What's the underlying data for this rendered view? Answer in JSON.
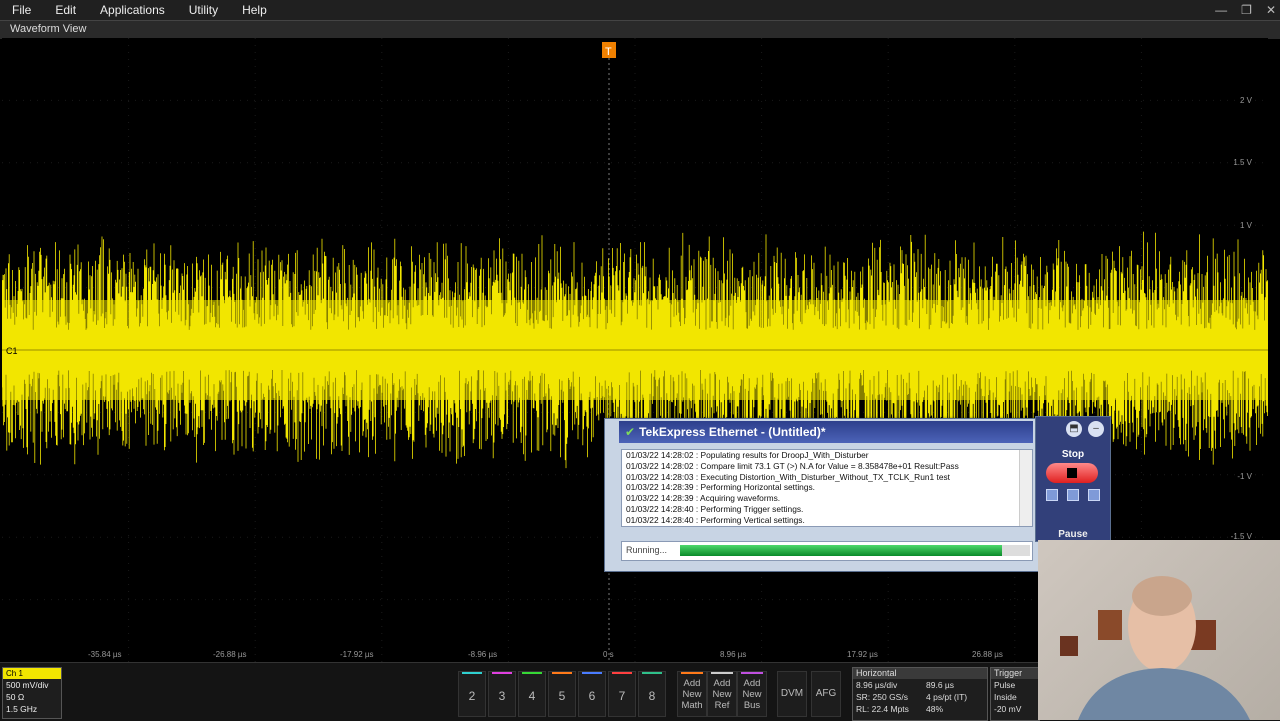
{
  "menu": {
    "items": [
      "File",
      "Edit",
      "Applications",
      "Utility",
      "Help"
    ]
  },
  "window_buttons": {
    "minimize": "—",
    "restore": "❐",
    "close": "✕"
  },
  "waveform_view": {
    "title": "Waveform View",
    "trigger_marker": "T",
    "ch_marker": "C1"
  },
  "v_axis_labels": [
    "2 V",
    "1.5 V",
    "1 V",
    "-1 V",
    "-1.5 V"
  ],
  "h_axis_labels": [
    "-35.84 µs",
    "-26.88 µs",
    "-17.92 µs",
    "-8.96 µs",
    "0 s",
    "8.96 µs",
    "17.92 µs",
    "26.88 µs"
  ],
  "tekexpress": {
    "title": "TekExpress Ethernet  - (Untitled)*",
    "log": [
      "01/03/22 14:28:02 : Populating results for DroopJ_With_Disturber",
      "01/03/22 14:28:02 : Compare limit 73.1 GT (>) N.A for Value = 8.358478e+01 Result:Pass",
      "01/03/22 14:28:03 : Executing Distortion_With_Disturber_Without_TX_TCLK_Run1 test",
      "01/03/22 14:28:39 : Performing Horizontal settings.",
      "01/03/22 14:28:39 : Acquiring waveforms.",
      "01/03/22 14:28:40 : Performing Trigger settings.",
      "01/03/22 14:28:40 : Performing Vertical settings."
    ],
    "status_label": "Running...",
    "progress": 0.92,
    "stop_label": "Stop",
    "pause_label": "Pause"
  },
  "ch1": {
    "label": "Ch 1",
    "scale": "500 mV/div",
    "impedance": "50 Ω",
    "bandwidth": "1.5 GHz"
  },
  "channel_buttons": [
    {
      "label": "2",
      "color": "#2fd0d0"
    },
    {
      "label": "3",
      "color": "#e040e0"
    },
    {
      "label": "4",
      "color": "#36d836"
    },
    {
      "label": "5",
      "color": "#ff7a1a"
    },
    {
      "label": "6",
      "color": "#4a7cff"
    },
    {
      "label": "7",
      "color": "#ff4040"
    },
    {
      "label": "8",
      "color": "#2fc08a"
    }
  ],
  "add_buttons": [
    {
      "line1": "Add",
      "line2": "New",
      "line3": "Math",
      "color": "#ff7a1a"
    },
    {
      "line1": "Add",
      "line2": "New",
      "line3": "Ref",
      "color": "#cccccc"
    },
    {
      "line1": "Add",
      "line2": "New",
      "line3": "Bus",
      "color": "#c050e0"
    }
  ],
  "tools": {
    "dvm": "DVM",
    "afg": "AFG"
  },
  "horizontal": {
    "title": "Horizontal",
    "scale": "8.96 µs/div",
    "position": "89.6 µs",
    "sample_rate": "SR: 250 GS/s",
    "pt_rate": "4 ps/pt (IT)",
    "record_length": "RL: 22.4 Mpts",
    "pct": "48%"
  },
  "trigger": {
    "title": "Trigger",
    "type": "Pulse",
    "cond": "Inside",
    "level": "-20 mV"
  },
  "colors": {
    "waveform": "#f2e600",
    "accent": "#f08000"
  }
}
